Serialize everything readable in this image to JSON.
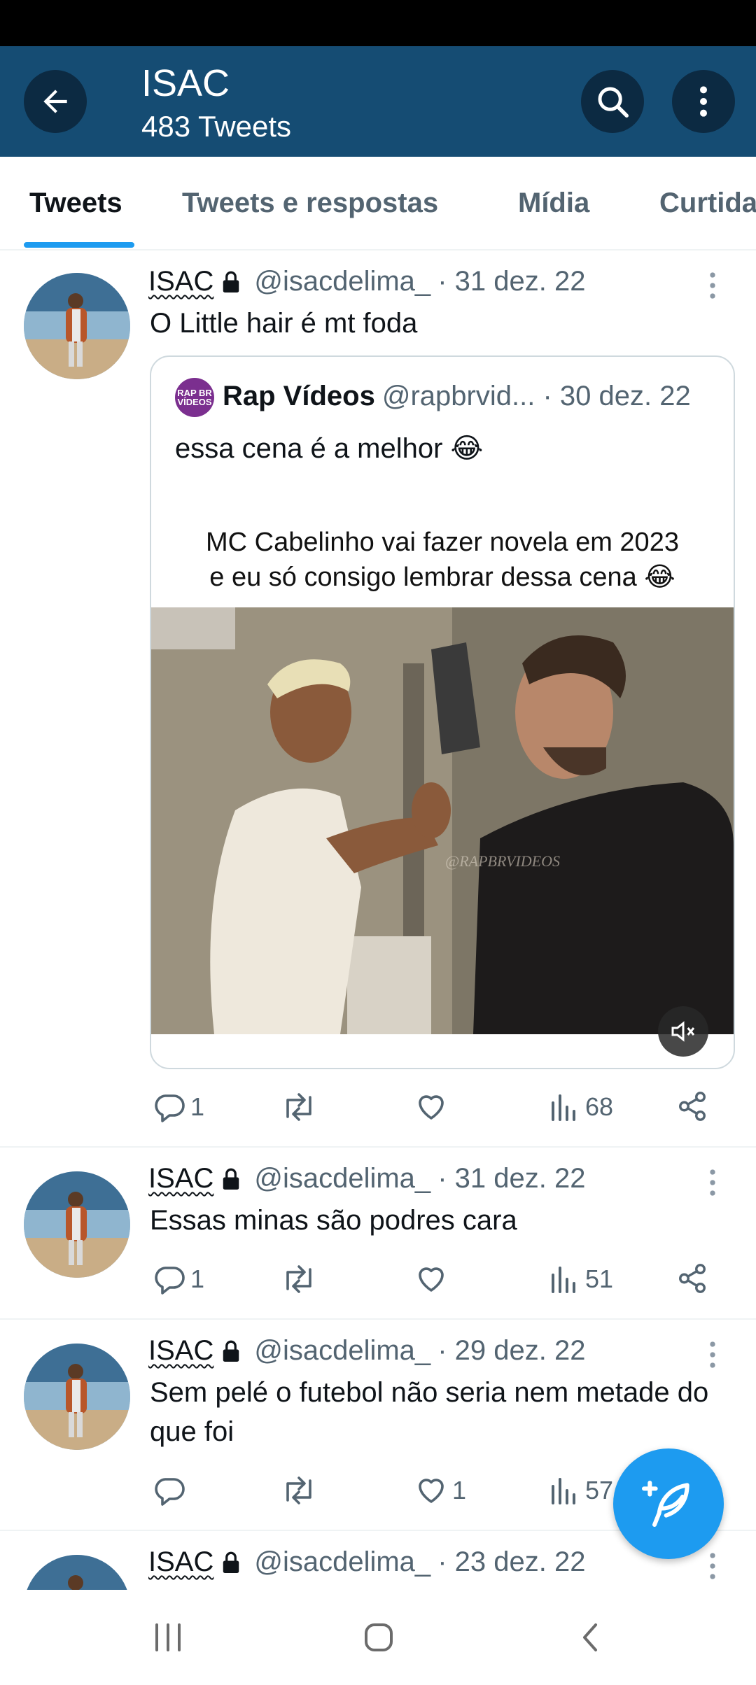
{
  "header": {
    "title": "ISAC",
    "subtitle": "483 Tweets",
    "back_icon": "arrow-left-icon",
    "search_icon": "search-icon",
    "more_icon": "more-vertical-icon",
    "bg_color": "#154c73"
  },
  "tabs": [
    "Tweets",
    "Tweets e respostas",
    "Mídia",
    "Curtidas"
  ],
  "active_tab": "Tweets",
  "accent_color": "#1d9bf0",
  "tweets": [
    {
      "name": "ISAC",
      "handle": "@isacdelima_",
      "date": "· 31 dez. 22",
      "text": "O Little hair é mt foda",
      "replies": "1",
      "retweets": "",
      "likes": "",
      "views": "68",
      "quote": {
        "name": "Rap Vídeos",
        "handle": "@rapbrvid...",
        "date": "· 30 dez. 22",
        "avatar_text": "RAP BR VÍDEOS",
        "text": "essa cena é a melhor 😂",
        "caption_line1": "MC Cabelinho vai fazer novela em 2023",
        "caption_line2": "e eu só consigo lembrar dessa cena 😂",
        "watermark": "@RAPBRVIDEOS"
      }
    },
    {
      "name": "ISAC",
      "handle": "@isacdelima_",
      "date": "· 31 dez. 22",
      "text": "Essas minas são podres cara",
      "replies": "1",
      "retweets": "",
      "likes": "",
      "views": "51"
    },
    {
      "name": "ISAC",
      "handle": "@isacdelima_",
      "date": "· 29 dez. 22",
      "text": "Sem pelé o futebol não seria nem metade do que foi",
      "replies": "",
      "retweets": "",
      "likes": "1",
      "views": "57"
    },
    {
      "name": "ISAC",
      "handle": "@isacdelima_",
      "date": "· 23 dez. 22"
    }
  ],
  "fab_icon": "compose-tweet-icon",
  "navbar": [
    "recent-apps-icon",
    "home-icon",
    "back-icon"
  ]
}
